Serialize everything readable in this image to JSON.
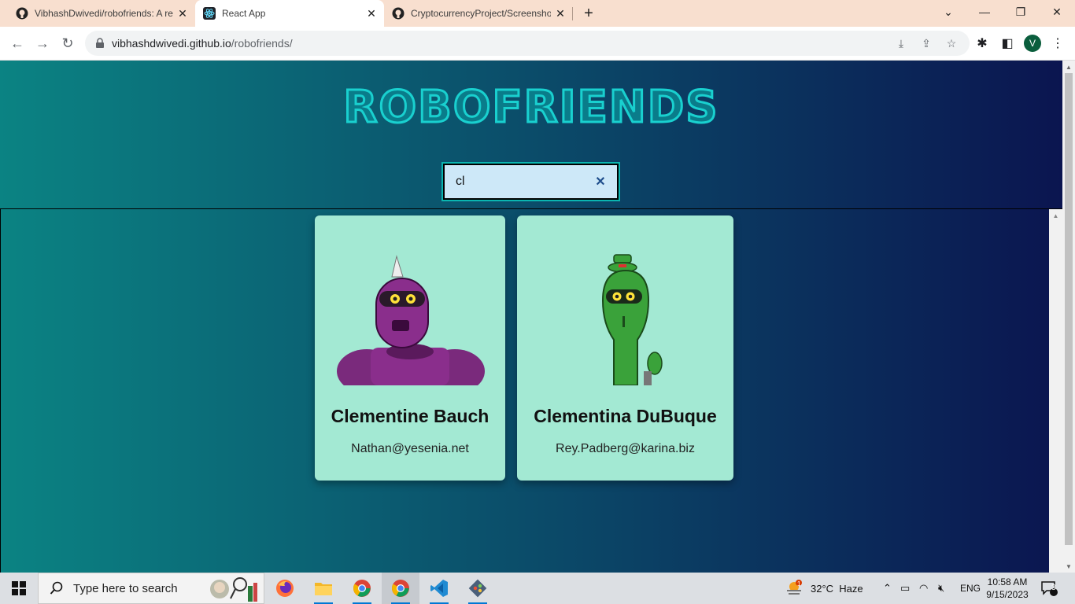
{
  "browser": {
    "tabs": [
      {
        "title": "VibhashDwivedi/robofriends: A re",
        "favicon": "github-icon"
      },
      {
        "title": "React App",
        "favicon": "react-icon"
      },
      {
        "title": "CryptocurrencyProject/Screensho",
        "favicon": "github-icon"
      }
    ],
    "active_tab": 1,
    "url_host": "vibhashdwivedi.github.io",
    "url_path": "/robofriends/",
    "profile_initial": "V"
  },
  "app": {
    "logo": "ROBOFRIENDS",
    "search_value": "cl",
    "clear_symbol": "✕",
    "robots": [
      {
        "name": "Clementine Bauch",
        "email": "Nathan@yesenia.net",
        "color": "#8a2e8c"
      },
      {
        "name": "Clementina DuBuque",
        "email": "Rey.Padberg@karina.biz",
        "color": "#3aa23a"
      }
    ]
  },
  "taskbar": {
    "search_placeholder": "Type here to search",
    "weather": "32°C  Haze",
    "weather_badge": "1",
    "language": "ENG",
    "time": "10:58 AM",
    "date": "9/15/2023",
    "notifications": "3"
  },
  "colors": {
    "gradient_start": "#0b8383",
    "gradient_end": "#0b1550",
    "card_bg": "#a3e9d3",
    "logo_stroke": "#19d0cf"
  }
}
